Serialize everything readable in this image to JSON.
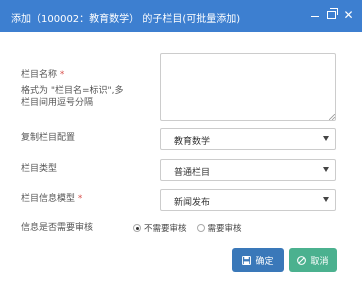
{
  "window": {
    "title": "添加（100002：教育数学） 的子栏目(可批量添加)",
    "minimize_icon": "minimize-icon",
    "maximize_icon": "maximize-icon",
    "close_icon": "close-icon"
  },
  "form": {
    "name_label": "栏目名称",
    "required_mark": "*",
    "name_hint_1": "格式为 \"栏目名=标识\",多",
    "name_hint_2": "栏目间用逗号分隔",
    "name_value": "",
    "copy_label": "复制栏目配置",
    "copy_value": "教育数学",
    "type_label": "栏目类型",
    "type_value": "普通栏目",
    "model_label": "栏目信息模型",
    "model_value": "新闻发布",
    "review_label": "信息是否需要审核",
    "review_options": [
      "不需要审核",
      "需要审核"
    ],
    "review_selected": "不需要审核"
  },
  "buttons": {
    "ok_label": "确定",
    "ok_icon": "save-icon",
    "cancel_label": "取消",
    "cancel_icon": "cancel-circle-icon"
  },
  "colors": {
    "titlebar": "#3d7fd0",
    "ok_button": "#3a78b9",
    "cancel_button": "#4bb18f",
    "required": "#d9534f"
  }
}
